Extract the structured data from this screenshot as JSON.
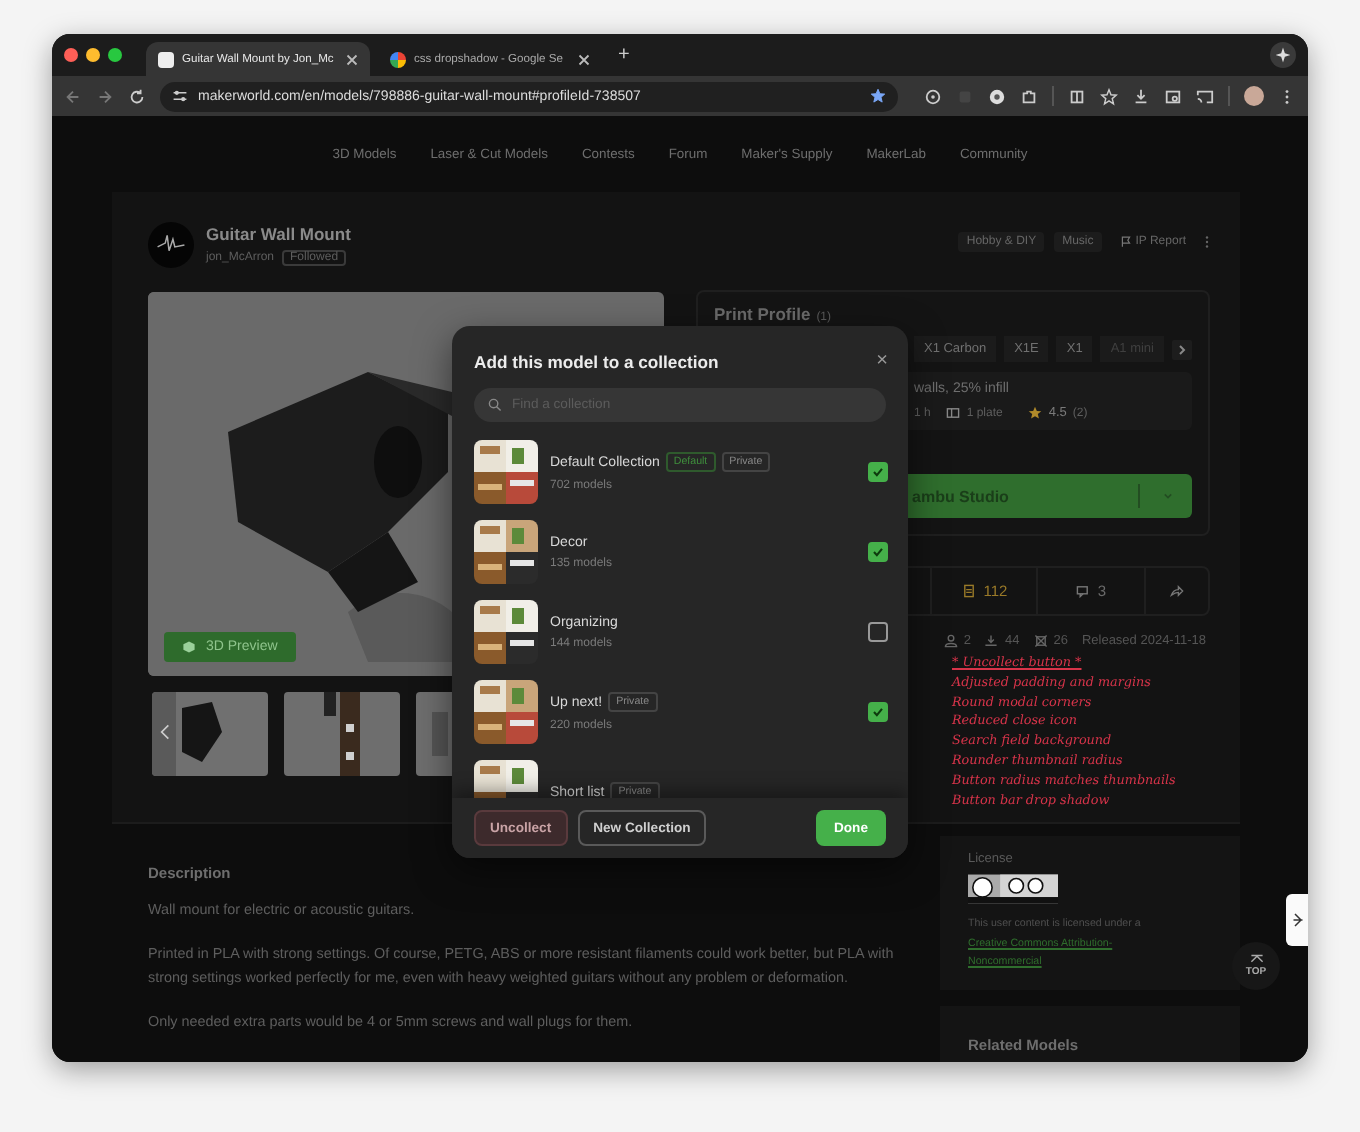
{
  "browser": {
    "tabs": [
      {
        "title": "Guitar Wall Mount by Jon_Mc",
        "selected": true
      },
      {
        "title": "css dropshadow - Google Se",
        "selected": false
      }
    ],
    "new_tab": "+",
    "url": "makerworld.com/en/models/798886-guitar-wall-mount#profileId-738507",
    "bookmarked": true
  },
  "nav": [
    "3D Models",
    "Laser & Cut Models",
    "Contests",
    "Forum",
    "Maker's Supply",
    "MakerLab",
    "Community"
  ],
  "model": {
    "title": "Guitar Wall Mount",
    "author": "jon_McArron",
    "follow": "Followed",
    "tags": [
      "Hobby & DIY",
      "Music"
    ],
    "report": "IP Report",
    "preview_button": "3D Preview"
  },
  "print_profile": {
    "title": "Print Profile",
    "count": "(1)",
    "printers": [
      "X1 Carbon",
      "X1E",
      "X1",
      "A1 mini"
    ],
    "profile": "walls, 25% infill",
    "time": "1 h",
    "plates": "1 plate",
    "rating": "4.5",
    "rating_count": "(2)",
    "open_button": "ambu Studio"
  },
  "stats": {
    "boosts": "112",
    "comments": "3"
  },
  "meta": {
    "makes": "2",
    "downloads": "44",
    "prints": "26",
    "released": "Released 2024-11-18"
  },
  "annotations": [
    "* Uncollect button *",
    "Adjusted padding and margins",
    "Round modal corners",
    "Reduced close icon",
    "Search field background",
    "Rounder thumbnail radius",
    "Button radius matches thumbnails",
    "Button bar drop shadow"
  ],
  "description": {
    "title": "Description",
    "paragraphs": [
      "Wall mount for electric or acoustic guitars.",
      "Printed in PLA with strong settings. Of course, PETG, ABS or more resistant filaments could work better, but PLA with strong settings worked perfectly for me, even with heavy weighted guitars without any problem or deformation.",
      "Only needed extra parts would be 4 or 5mm screws and wall plugs for them."
    ]
  },
  "license": {
    "title": "License",
    "text": "This user content is licensed under a",
    "link": "Creative Commons Attribution-Noncommercial"
  },
  "related": {
    "title": "Related Models"
  },
  "top_button": "TOP",
  "modal": {
    "title": "Add this model to a collection",
    "close": "×",
    "search": {
      "placeholder": "Find a collection"
    },
    "collections": [
      {
        "name": "Default Collection",
        "count": "702 models",
        "tags": [
          {
            "label": "Default",
            "kind": "default"
          },
          {
            "label": "Private",
            "kind": "private"
          }
        ],
        "checked": true
      },
      {
        "name": "Decor",
        "count": "135 models",
        "checked": true
      },
      {
        "name": "Organizing",
        "count": "144 models",
        "checked": false
      },
      {
        "name": "Up next!",
        "count": "220 models",
        "tags": [
          {
            "label": "Private",
            "kind": "private"
          }
        ],
        "checked": true
      },
      {
        "name": "Short list",
        "tags": [
          {
            "label": "Private",
            "kind": "private"
          }
        ]
      }
    ],
    "buttons": [
      {
        "label": "Uncollect",
        "kind": "danger"
      },
      {
        "label": "New Collection",
        "kind": "outline"
      },
      {
        "label": "Done",
        "kind": "primary"
      }
    ]
  }
}
